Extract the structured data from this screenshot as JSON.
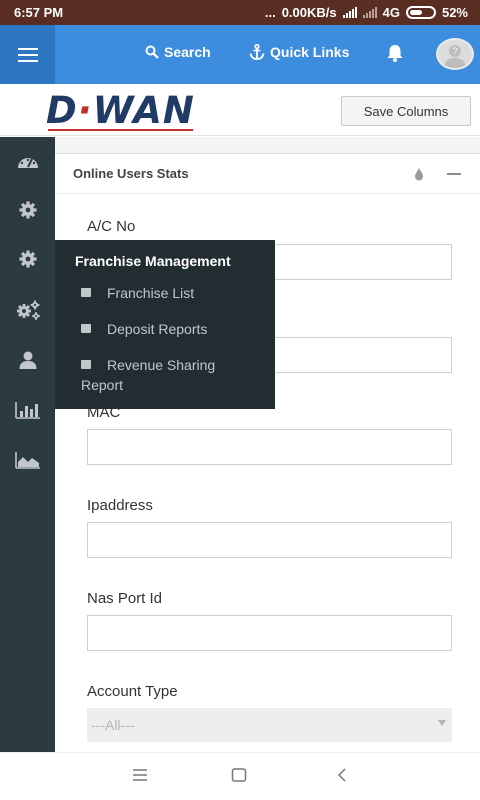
{
  "status_bar": {
    "time": "6:57 PM",
    "dots": "...",
    "speed": "0.00KB/s",
    "network": "4G",
    "battery": "52%"
  },
  "top_nav": {
    "search_label": "Search",
    "quick_links_label": "Quick Links",
    "bell_icon": "bell-icon",
    "avatar_glyph": "?"
  },
  "logo_bar": {
    "logo_text_start": "D",
    "logo_dot": "·",
    "logo_text_end": "WAN",
    "save_columns_label": "Save Columns"
  },
  "sidebar": {
    "items": [
      {
        "icon": "dashboard-icon"
      },
      {
        "icon": "gear-icon"
      },
      {
        "icon": "gear-icon"
      },
      {
        "icon": "gears-icon"
      },
      {
        "icon": "user-icon"
      },
      {
        "icon": "bar-chart-icon"
      },
      {
        "icon": "area-chart-icon"
      }
    ]
  },
  "flyout": {
    "title": "Franchise Management",
    "items": [
      {
        "label": "Franchise List"
      },
      {
        "label": "Deposit Reports"
      },
      {
        "label": "Revenue Sharing",
        "label_line2": "Report"
      }
    ]
  },
  "panel": {
    "title": "Online Users Stats",
    "fields": [
      {
        "label": "A/C No"
      },
      {
        "label": "MAC"
      },
      {
        "label": "Ipaddress"
      },
      {
        "label": "Nas Port Id"
      },
      {
        "label": "Account Type",
        "selected": "---All---"
      }
    ]
  },
  "colors": {
    "status_bar": "#5a2d22",
    "top_nav": "#3c8dde",
    "sidebar": "#2c3b41",
    "flyout": "#222d32",
    "logo_blue": "#1f3b66",
    "logo_red": "#c0302c"
  }
}
